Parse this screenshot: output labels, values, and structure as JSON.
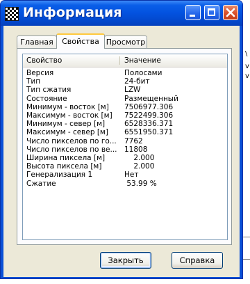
{
  "window": {
    "title": "Информация",
    "title_buttons": {
      "minimize": "minimize-icon",
      "maximize": "maximize-icon",
      "close": "close-icon"
    }
  },
  "tabs": [
    {
      "label": "Главная",
      "active": false
    },
    {
      "label": "Свойства",
      "active": true
    },
    {
      "label": "Просмотр",
      "active": false
    }
  ],
  "list": {
    "columns": [
      "Свойство",
      "Значение"
    ],
    "rows": [
      {
        "property": "Версия",
        "value": "Полосами"
      },
      {
        "property": "Тип",
        "value": "24-бит"
      },
      {
        "property": "Тип сжатия",
        "value": "LZW"
      },
      {
        "property": "Состояние",
        "value": "Размещенный"
      },
      {
        "property": "Минимум - восток [м]",
        "value": "7506977.306"
      },
      {
        "property": "Максимум - восток [м]",
        "value": "7522499.306"
      },
      {
        "property": "Минимум - север [м]",
        "value": "6528336.371"
      },
      {
        "property": "Максимум - север [м]",
        "value": "6551950.371"
      },
      {
        "property": "Число пикселов по го...",
        "value": "7762"
      },
      {
        "property": "Число пикселов по ве...",
        "value": "11808"
      },
      {
        "property": "Ширина пиксела [м]",
        "value": "    2.000"
      },
      {
        "property": "Высота пиксела [м]",
        "value": "    2.000"
      },
      {
        "property": "Генерализация 1",
        "value": "Нет"
      },
      {
        "property": "Сжатие",
        "value": " 53.99 %"
      }
    ]
  },
  "buttons": {
    "close_label": "Закрыть",
    "help_label": "Справка"
  },
  "background_fragments": [
    "\\",
    "v",
    "v"
  ],
  "colors": {
    "title_bar": "#0352df",
    "dialog_face": "#ece9d8",
    "active_tab_accent": "#ffc83c"
  }
}
